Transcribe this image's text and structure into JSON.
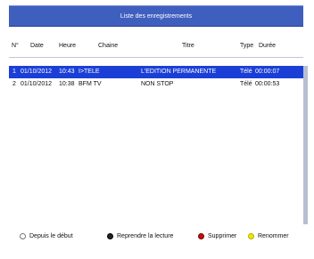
{
  "header": {
    "title": "Liste des enregistrements"
  },
  "columns": {
    "num": "N°",
    "date": "Date",
    "heure": "Heure",
    "chaine": "Chaine",
    "titre": "Titre",
    "type": "Type",
    "duree": "Durée"
  },
  "recordings": [
    {
      "num": "1",
      "date": "01/10/2012",
      "heure": "10:43",
      "chaine": "I>TELE",
      "titre": "L'EDITION PERMANENTE",
      "type": "Télé",
      "duree": "00:00:07"
    },
    {
      "num": "2",
      "date": "01/10/2012",
      "heure": "10:38",
      "chaine": "BFM TV",
      "titre": "NON STOP",
      "type": "Télé",
      "duree": "00:00:53"
    }
  ],
  "legend": {
    "white": "Depuis le début",
    "black": "Reprendre la lecture",
    "red": "Supprimer",
    "yellow": "Renommer"
  },
  "colors": {
    "title_bar": "#3f5fbf",
    "selected_row": "#1b3fd6",
    "red_key": "#c10f0f",
    "yellow_key": "#f2e600"
  }
}
